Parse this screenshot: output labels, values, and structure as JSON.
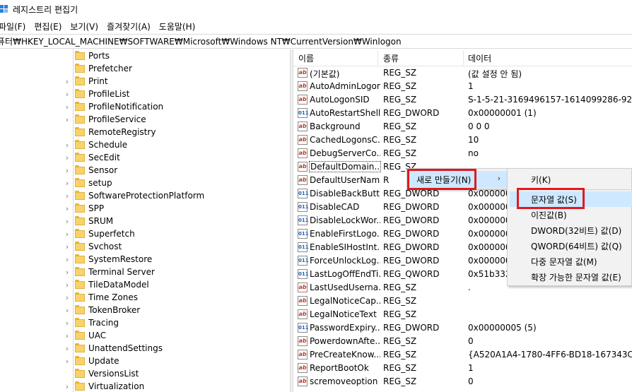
{
  "window": {
    "title": "레지스트리 편집기"
  },
  "menu": [
    "파일(F)",
    "편집(E)",
    "보기(V)",
    "즐겨찾기(A)",
    "도움말(H)"
  ],
  "address": "퓨터₩HKEY_LOCAL_MACHINE₩SOFTWARE₩Microsoft₩Windows NT₩CurrentVersion₩Winlogon",
  "tree": [
    {
      "label": "Ports",
      "expandable": false
    },
    {
      "label": "Prefetcher",
      "expandable": false
    },
    {
      "label": "Print",
      "expandable": true
    },
    {
      "label": "ProfileList",
      "expandable": true
    },
    {
      "label": "ProfileNotification",
      "expandable": true
    },
    {
      "label": "ProfileService",
      "expandable": true
    },
    {
      "label": "RemoteRegistry",
      "expandable": false
    },
    {
      "label": "Schedule",
      "expandable": true
    },
    {
      "label": "SecEdit",
      "expandable": true
    },
    {
      "label": "Sensor",
      "expandable": true
    },
    {
      "label": "setup",
      "expandable": true
    },
    {
      "label": "SoftwareProtectionPlatform",
      "expandable": true
    },
    {
      "label": "SPP",
      "expandable": true
    },
    {
      "label": "SRUM",
      "expandable": true
    },
    {
      "label": "Superfetch",
      "expandable": true
    },
    {
      "label": "Svchost",
      "expandable": true
    },
    {
      "label": "SystemRestore",
      "expandable": true
    },
    {
      "label": "Terminal Server",
      "expandable": true
    },
    {
      "label": "TileDataModel",
      "expandable": true
    },
    {
      "label": "Time Zones",
      "expandable": true
    },
    {
      "label": "TokenBroker",
      "expandable": true
    },
    {
      "label": "Tracing",
      "expandable": true
    },
    {
      "label": "UAC",
      "expandable": true
    },
    {
      "label": "UnattendSettings",
      "expandable": true
    },
    {
      "label": "Update",
      "expandable": true
    },
    {
      "label": "VersionsList",
      "expandable": false
    },
    {
      "label": "Virtualization",
      "expandable": true
    }
  ],
  "list": {
    "headers": {
      "name": "이름",
      "type": "종류",
      "data": "데이터"
    },
    "rows": [
      {
        "icon": "string-value-icon",
        "name": "(기본값)",
        "type": "REG_SZ",
        "data": "(값 설정 안 됨)"
      },
      {
        "icon": "string-value-icon",
        "name": "AutoAdminLogon",
        "type": "REG_SZ",
        "data": "1"
      },
      {
        "icon": "string-value-icon",
        "name": "AutoLogonSID",
        "type": "REG_SZ",
        "data": "S-1-5-21-3169496157-1614099286-9298"
      },
      {
        "icon": "binary-value-icon",
        "name": "AutoRestartShell",
        "type": "REG_DWORD",
        "data": "0x00000001 (1)"
      },
      {
        "icon": "string-value-icon",
        "name": "Background",
        "type": "REG_SZ",
        "data": "0 0 0"
      },
      {
        "icon": "string-value-icon",
        "name": "CachedLogonsC...",
        "type": "REG_SZ",
        "data": "10"
      },
      {
        "icon": "string-value-icon",
        "name": "DebugServerCo...",
        "type": "REG_SZ",
        "data": "no"
      },
      {
        "icon": "string-value-icon",
        "name": "DefaultDomain...",
        "type": "REG_SZ",
        "data": ""
      },
      {
        "icon": "string-value-icon",
        "name": "DefaultUserName",
        "type": "R",
        "data": ""
      },
      {
        "icon": "binary-value-icon",
        "name": "DisableBackButt...",
        "type": "REG_DWORD",
        "data": "0x000000"
      },
      {
        "icon": "binary-value-icon",
        "name": "DisableCAD",
        "type": "REG_DWORD",
        "data": "0x000000"
      },
      {
        "icon": "binary-value-icon",
        "name": "DisableLockWor...",
        "type": "REG_DWORD",
        "data": "0x000000"
      },
      {
        "icon": "binary-value-icon",
        "name": "EnableFirstLogo...",
        "type": "REG_DWORD",
        "data": "0x000000"
      },
      {
        "icon": "binary-value-icon",
        "name": "EnableSIHostInt...",
        "type": "REG_DWORD",
        "data": "0x000000"
      },
      {
        "icon": "binary-value-icon",
        "name": "ForceUnlockLog...",
        "type": "REG_DWORD",
        "data": "0x000000"
      },
      {
        "icon": "binary-value-icon",
        "name": "LastLogOffEndTi...",
        "type": "REG_QWORD",
        "data": "0x51b332"
      },
      {
        "icon": "string-value-icon",
        "name": "LastUsedUserna...",
        "type": "REG_SZ",
        "data": "."
      },
      {
        "icon": "string-value-icon",
        "name": "LegalNoticeCap...",
        "type": "REG_SZ",
        "data": ""
      },
      {
        "icon": "string-value-icon",
        "name": "LegalNoticeText",
        "type": "REG_SZ",
        "data": ""
      },
      {
        "icon": "binary-value-icon",
        "name": "PasswordExpiry...",
        "type": "REG_DWORD",
        "data": "0x00000005 (5)"
      },
      {
        "icon": "string-value-icon",
        "name": "PowerdownAfte...",
        "type": "REG_SZ",
        "data": "0"
      },
      {
        "icon": "string-value-icon",
        "name": "PreCreateKnow...",
        "type": "REG_SZ",
        "data": "{A520A1A4-1780-4FF6-BD18-167343C5A"
      },
      {
        "icon": "string-value-icon",
        "name": "ReportBootOk",
        "type": "REG_SZ",
        "data": "1"
      },
      {
        "icon": "string-value-icon",
        "name": "scremoveoption",
        "type": "REG_SZ",
        "data": "0"
      }
    ]
  },
  "context_menu": {
    "new_label": "새로 만들기(N)",
    "new_arrow": "›"
  },
  "submenu": {
    "key": "키(K)",
    "string_value": "문자열 값(S)",
    "binary_value": "이진값(B)",
    "dword_value": "DWORD(32비트) 값(D)",
    "qword_value": "QWORD(64비트) 값(Q)",
    "multi_string": "다중 문자열 값(M)",
    "expandable_string": "확장 가능한 문자열 값(E)"
  },
  "colors": {
    "highlight": "#cde8ff",
    "annotation_red": "#e0191e",
    "folder_yellow": "#f8d36a"
  }
}
